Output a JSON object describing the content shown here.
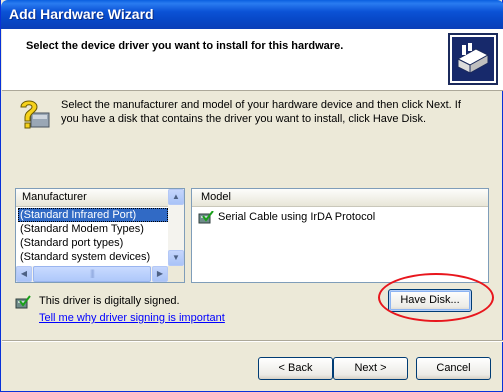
{
  "window": {
    "title": "Add Hardware Wizard"
  },
  "header": {
    "heading": "Select the device driver you want to install for this hardware.",
    "icon": "hardware-wizard-icon"
  },
  "info": {
    "icon": "question-icon",
    "text": "Select the manufacturer and model of your hardware device and then click Next. If you have a disk that contains the driver you want to install, click Have Disk."
  },
  "manufacturer": {
    "header": "Manufacturer",
    "items": [
      {
        "label": "(Standard Infrared Port)",
        "selected": true
      },
      {
        "label": "(Standard Modem Types)",
        "selected": false
      },
      {
        "label": "(Standard port types)",
        "selected": false
      },
      {
        "label": "(Standard system devices)",
        "selected": false
      }
    ]
  },
  "model": {
    "header": "Model",
    "items": [
      {
        "label": "Serial Cable using IrDA Protocol",
        "icon": "certified-driver-icon"
      }
    ]
  },
  "signing": {
    "status": "This driver is digitally signed.",
    "link": "Tell me why driver signing is important"
  },
  "buttons": {
    "have_disk": "Have Disk...",
    "back": "< Back",
    "next": "Next >",
    "cancel": "Cancel"
  },
  "colors": {
    "accent": "#316ac5",
    "titlebar": "#0a52d6",
    "highlight_ellipse": "#e8161d"
  }
}
